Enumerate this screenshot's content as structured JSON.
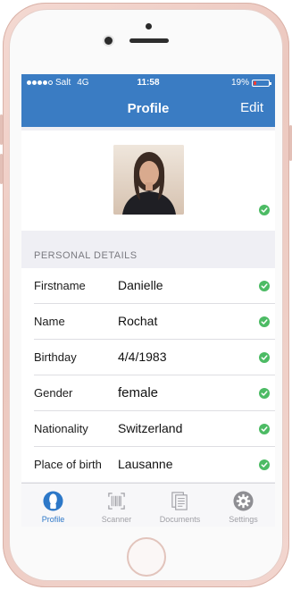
{
  "status_bar": {
    "carrier": "Salt",
    "network": "4G",
    "time": "11:58",
    "battery_percent": "19%",
    "battery_level": 0.19,
    "battery_color": "#ff3b30"
  },
  "nav": {
    "title": "Profile",
    "edit_label": "Edit"
  },
  "profile_photo": {
    "verified_icon": "check-circle-icon"
  },
  "section": {
    "title": "PERSONAL DETAILS"
  },
  "details": [
    {
      "label": "Firstname",
      "value": "Danielle"
    },
    {
      "label": "Name",
      "value": "Rochat"
    },
    {
      "label": "Birthday",
      "value": "4/4/1983"
    },
    {
      "label": "Gender",
      "value": "female"
    },
    {
      "label": "Nationality",
      "value": "Switzerland"
    },
    {
      "label": "Place of birth",
      "value": "Lausanne"
    }
  ],
  "tabs": [
    {
      "label": "Profile",
      "icon": "person-icon",
      "active": true
    },
    {
      "label": "Scanner",
      "icon": "barcode-icon",
      "active": false
    },
    {
      "label": "Documents",
      "icon": "documents-icon",
      "active": false
    },
    {
      "label": "Settings",
      "icon": "gear-icon",
      "active": false
    }
  ],
  "colors": {
    "brand_blue": "#3a7cc3",
    "verified_green": "#4cbb64",
    "tab_active": "#2d78c8",
    "tab_inactive": "#a0a0a6"
  }
}
